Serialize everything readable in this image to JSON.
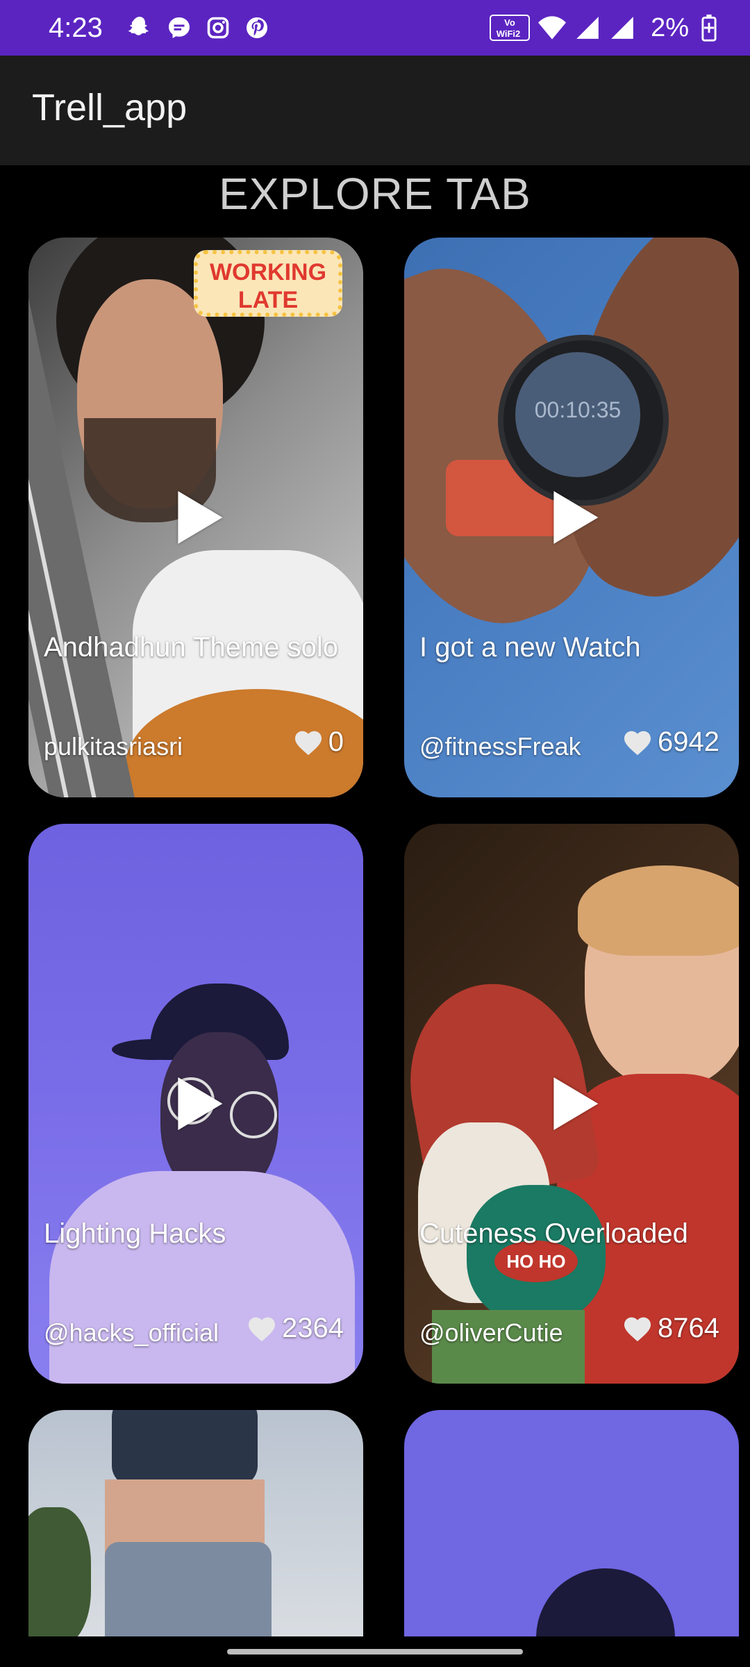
{
  "status": {
    "time": "4:23",
    "battery": "2%",
    "left_icons": [
      "snapchat-icon",
      "messenger-icon",
      "instagram-icon",
      "pinterest-icon"
    ],
    "right_icons": [
      "vowifi-icon",
      "wifi-icon",
      "signal-icon",
      "signal-icon",
      "battery-icon"
    ],
    "vowifi_label": "Vo WiFi 2"
  },
  "app": {
    "title": "Trell_app"
  },
  "explore": {
    "heading": "EXPLORE TAB"
  },
  "cards": [
    {
      "caption": "Andhadhun Theme solo",
      "author": "pulkitasriasri",
      "likes": "0",
      "sticker_line1": "WORKING",
      "sticker_line2": "LATE",
      "watch_text": ""
    },
    {
      "caption": "I got a new Watch",
      "author": "@fitnessFreak",
      "likes": "6942",
      "watch_text": "00:10:35"
    },
    {
      "caption": "Lighting Hacks",
      "author": "@hacks_official",
      "likes": "2364"
    },
    {
      "caption": "Cuteness Overloaded",
      "author": "@oliverCutie",
      "likes": "8764",
      "badge_text": "HO HO"
    },
    {
      "caption": "",
      "author": "",
      "likes": ""
    },
    {
      "caption": "",
      "author": "",
      "likes": ""
    }
  ],
  "colors": {
    "status_bar": "#5b24c1",
    "app_bar": "#1c1c1c",
    "background": "#000000",
    "heading_text": "#cfcfcf"
  }
}
